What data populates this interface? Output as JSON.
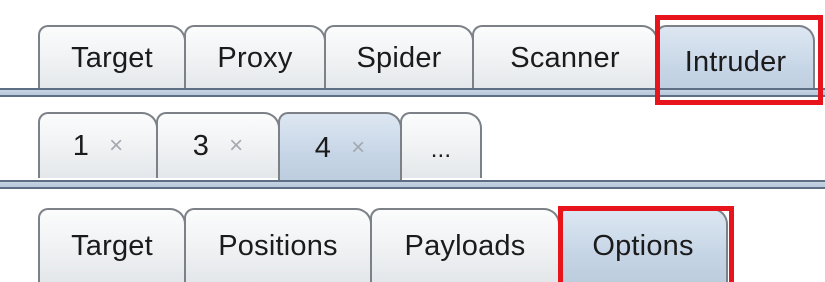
{
  "main_tabs": [
    {
      "label": "Target"
    },
    {
      "label": "Proxy"
    },
    {
      "label": "Spider"
    },
    {
      "label": "Scanner"
    },
    {
      "label": "Intruder",
      "selected": true
    }
  ],
  "intruder_attack_tabs": [
    {
      "label": "1",
      "close": "×"
    },
    {
      "label": "3",
      "close": "×"
    },
    {
      "label": "4",
      "close": "×",
      "selected": true
    },
    {
      "label": "..."
    }
  ],
  "attack_subtabs": [
    {
      "label": "Target"
    },
    {
      "label": "Positions"
    },
    {
      "label": "Payloads"
    },
    {
      "label": "Options",
      "selected": true
    }
  ],
  "colors": {
    "highlight": "#e8141c",
    "selected_tab": "#c6d5e6",
    "tab_border": "#7c8188"
  }
}
